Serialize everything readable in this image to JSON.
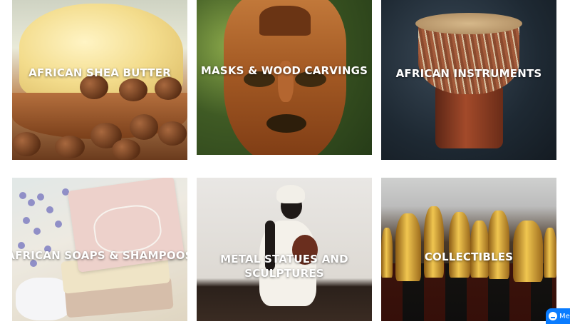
{
  "categories": [
    {
      "id": "shea-butter",
      "label": "AFRICAN SHEA BUTTER"
    },
    {
      "id": "masks",
      "label": "MASKS & WOOD CARVINGS"
    },
    {
      "id": "instruments",
      "label": "AFRICAN INSTRUMENTS"
    },
    {
      "id": "soaps",
      "label": "AFRICAN SOAPS & SHAMPOOS"
    },
    {
      "id": "statues",
      "label": "METAL STATUES AND SCULPTURES"
    },
    {
      "id": "collectibles",
      "label": "COLLECTIBLES"
    }
  ],
  "messenger": {
    "label": "Mes",
    "icon": "messenger-icon"
  },
  "colors": {
    "label_text": "#ffffff",
    "messenger": "#0a7cff"
  }
}
